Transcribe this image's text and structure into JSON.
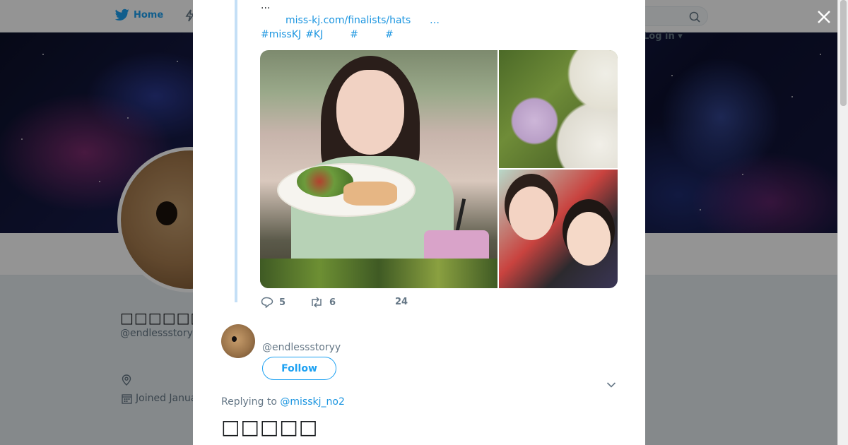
{
  "nav": {
    "home_label": "Home",
    "login_label": "Log in",
    "icons": [
      "twitter-bird-icon",
      "lightning-icon",
      "search-icon"
    ]
  },
  "profile": {
    "name": "□□□□□□□□□",
    "handle": "@endlessstoryy",
    "joined": "Joined Janua",
    "icons": [
      "location-icon",
      "calendar-icon"
    ]
  },
  "tweet": {
    "ellipsis": "...",
    "link": "miss-kj.com/finalists/hats",
    "link_more": "…",
    "hashtags": [
      "#missKJ",
      "#KJ",
      "#",
      "#"
    ],
    "stats": {
      "replies": "5",
      "retweets": "6",
      "likes": "24"
    }
  },
  "reply": {
    "handle": "@endlessstoryy",
    "follow_label": "Follow",
    "replying_prefix": "Replying to",
    "replying_to": "@misskj_no2",
    "text": "□□□□□"
  },
  "colors": {
    "brand": "#1da1f2",
    "link": "#1b95e0",
    "muted": "#657786",
    "thread_line": "#c4dff6"
  }
}
